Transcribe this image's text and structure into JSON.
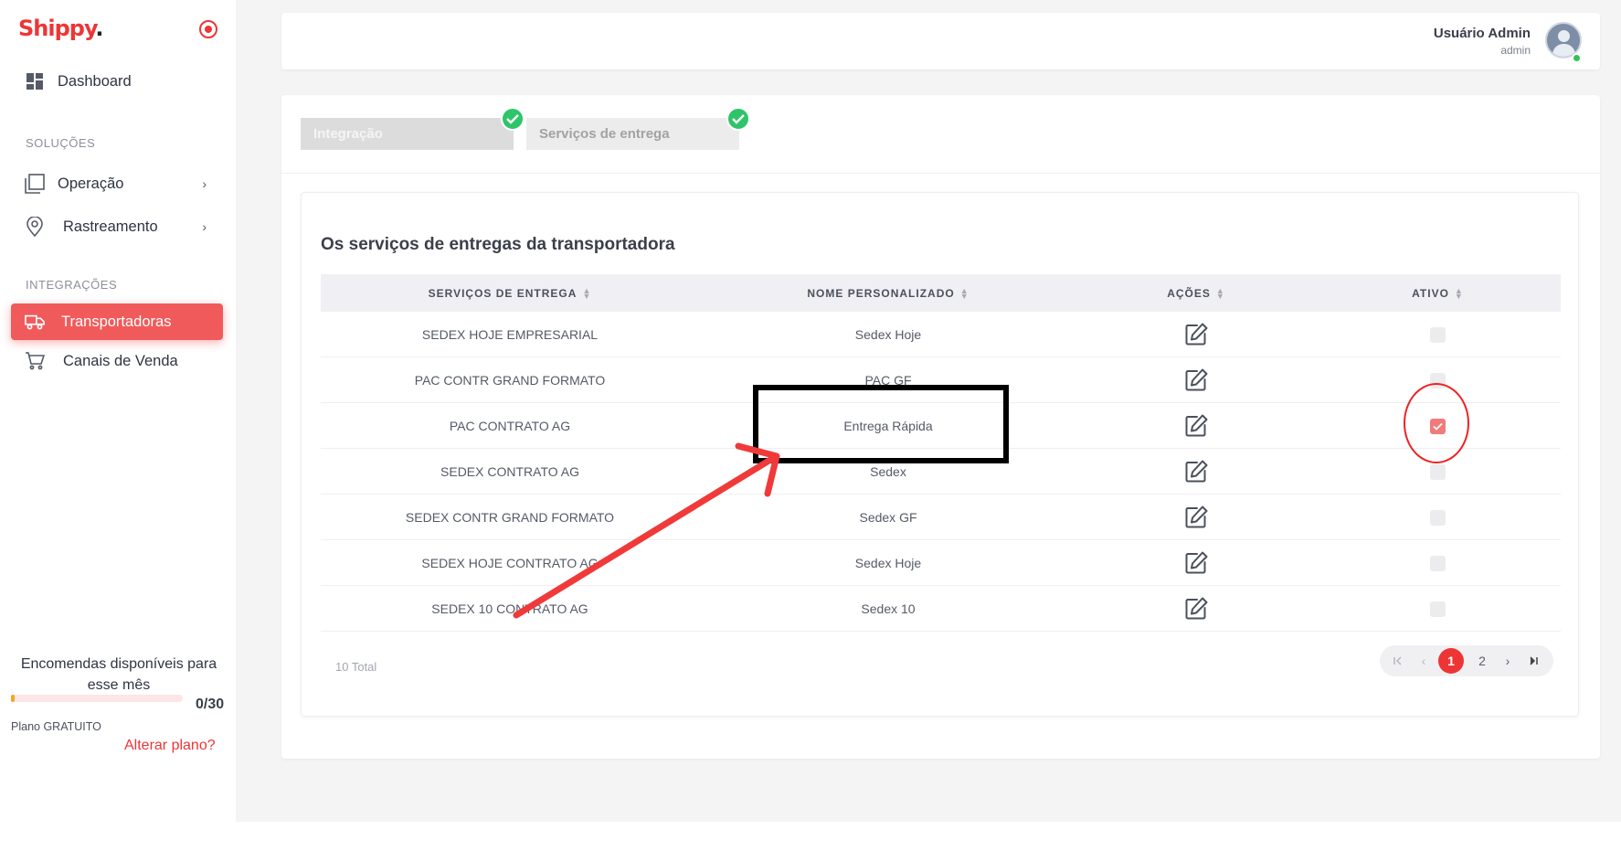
{
  "brand": {
    "name": "Shippy",
    "dot": "."
  },
  "sidebar": {
    "dashboard": "Dashboard",
    "section_solutions": "SOLUÇÕES",
    "operacao": "Operação",
    "rastreamento": "Rastreamento",
    "section_integrations": "INTEGRAÇÕES",
    "transportadoras": "Transportadoras",
    "canais": "Canais de Venda",
    "quota_text": "Encomendas disponíveis para esse mês",
    "quota_count": "0/30",
    "quota_progress": 0,
    "plan": "Plano GRATUITO",
    "change_plan": "Alterar plano?"
  },
  "header": {
    "user_name": "Usuário Admin",
    "user_role": "admin"
  },
  "tabs": [
    {
      "label": "Integração",
      "completed": true
    },
    {
      "label": "Serviços de entrega",
      "completed": true
    }
  ],
  "section_title": "Os serviços de entregas da transportadora",
  "table": {
    "headers": [
      "SERVIÇOS DE ENTREGA",
      "NOME PERSONALIZADO",
      "AÇÕES",
      "ATIVO"
    ],
    "rows": [
      {
        "service": "SEDEX HOJE EMPRESARIAL",
        "custom_name": "Sedex Hoje",
        "active": false
      },
      {
        "service": "PAC CONTR GRAND FORMATO",
        "custom_name": "PAC GF",
        "active": false
      },
      {
        "service": "PAC CONTRATO AG",
        "custom_name": "Entrega Rápida",
        "active": true
      },
      {
        "service": "SEDEX CONTRATO AG",
        "custom_name": "Sedex",
        "active": false
      },
      {
        "service": "SEDEX CONTR GRAND FORMATO",
        "custom_name": "Sedex GF",
        "active": false
      },
      {
        "service": "SEDEX HOJE CONTRATO AG",
        "custom_name": "Sedex Hoje",
        "active": false
      },
      {
        "service": "SEDEX 10 CONTRATO AG",
        "custom_name": "Sedex 10",
        "active": false
      }
    ]
  },
  "pagination": {
    "total": "10 Total",
    "pages": [
      "1",
      "2"
    ],
    "current": "1"
  },
  "colors": {
    "brand": "#ee3535",
    "active_nav": "#f15a5a",
    "check_green": "#2ec56a",
    "annotation_red": "#ee2222"
  }
}
